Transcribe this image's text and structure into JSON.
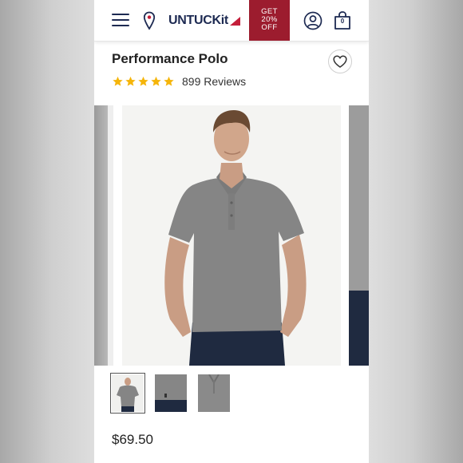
{
  "header": {
    "logo_text": "UNTUCKit",
    "promo_line1": "GET",
    "promo_line2": "20%",
    "promo_line3": "OFF",
    "cart_count": "0",
    "icons": [
      "menu-icon",
      "store-locator-pin-icon",
      "account-icon",
      "shopping-bag-icon"
    ]
  },
  "product": {
    "name": "Performance Polo",
    "rating": 5,
    "reviews": "899 Reviews",
    "price": "$69.50"
  },
  "gallery": {
    "thumbnail_count": 3,
    "selected_thumbnail": 1
  },
  "colors": {
    "brand_navy": "#1d2a52",
    "promo_red": "#9c1c2e",
    "star_gold": "#f5b50a",
    "shirt_gray": "#808080"
  }
}
